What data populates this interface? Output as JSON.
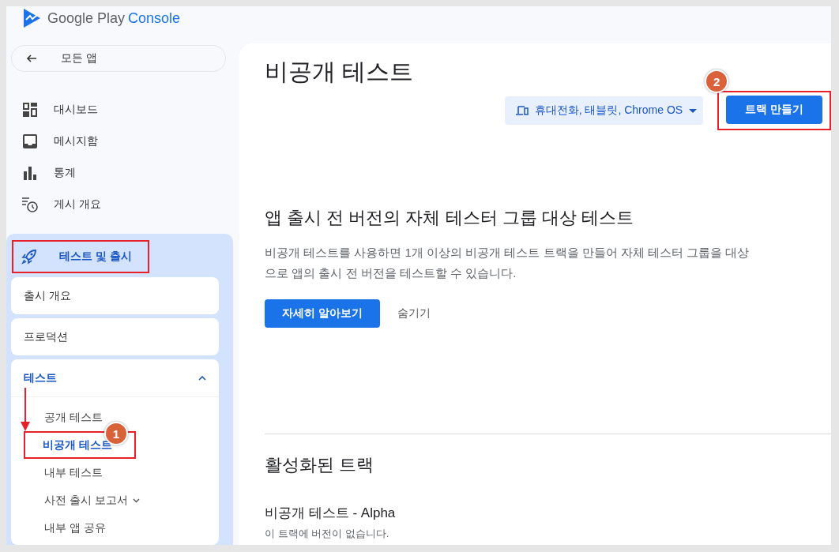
{
  "brand": {
    "name": "Google Play",
    "product": "Console"
  },
  "back_button": {
    "label": "모든 앱"
  },
  "nav": [
    {
      "label": "대시보드",
      "kind": "dashboard"
    },
    {
      "label": "메시지함",
      "kind": "inbox"
    },
    {
      "label": "통계",
      "kind": "stats"
    },
    {
      "label": "게시 개요",
      "kind": "schedule"
    }
  ],
  "release_section": {
    "label": "테스트 및 출시",
    "boxed": true,
    "cards": [
      {
        "label": "출시 개요",
        "expanded": false
      },
      {
        "label": "프로덕션",
        "expanded": false
      },
      {
        "label": "테스트",
        "expanded": true,
        "children": [
          {
            "label": "공개 테스트",
            "selected": false,
            "boxed": false,
            "has_submenu": false
          },
          {
            "label": "비공개 테스트",
            "selected": true,
            "boxed": true,
            "marker": "1",
            "has_submenu": false
          },
          {
            "label": "내부 테스트",
            "selected": false,
            "boxed": false,
            "has_submenu": false
          },
          {
            "label": "사전 출시 보고서",
            "selected": false,
            "boxed": false,
            "has_submenu": true
          },
          {
            "label": "내부 앱 공유",
            "selected": false,
            "boxed": false,
            "has_submenu": false
          }
        ]
      }
    ]
  },
  "page": {
    "title": "비공개 테스트",
    "device_filter": "휴대전화, 태블릿, Chrome OS",
    "create_button": {
      "label": "트랙 만들기",
      "boxed": true,
      "marker": "2"
    },
    "intro": {
      "heading": "앱 출시 전 버전의 자체 테스터 그룹 대상 테스트",
      "body": "비공개 테스트를 사용하면 1개 이상의 비공개 테스트 트랙을 만들어 자체 테스터 그룹을 대상으로 앱의 출시 전 버전을 테스트할 수 있습니다.",
      "learn_more": "자세히 알아보기",
      "hide": "숨기기"
    },
    "active_tracks": {
      "heading": "활성화된 트랙",
      "tracks": [
        {
          "name": "비공개 테스트 - Alpha",
          "status": "이 트랙에 버전이 없습니다."
        }
      ]
    }
  }
}
